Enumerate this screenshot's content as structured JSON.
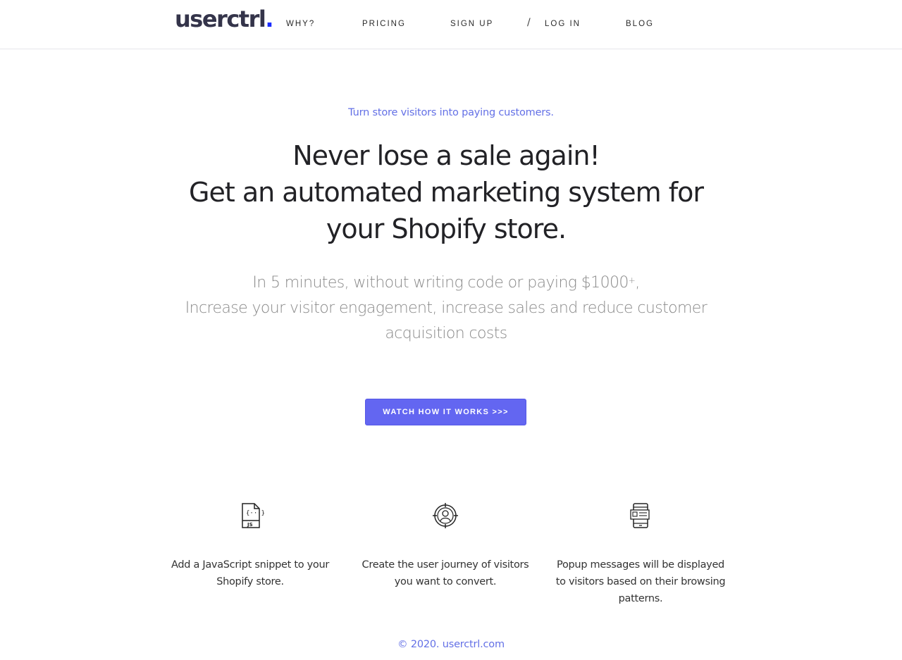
{
  "header": {
    "logo_text": "userctrl",
    "logo_dot": ".",
    "nav": {
      "why": "WHY?",
      "pricing": "PRICING",
      "signup": "SIGN UP",
      "separator": "/",
      "login": "LOG IN",
      "blog": "BLOG"
    }
  },
  "hero": {
    "tagline": "Turn store visitors into paying customers.",
    "headline_line1": "Never lose a sale again!",
    "headline_line2": "Get an automated marketing system for",
    "headline_line3": "your Shopify store.",
    "sub_line1_a": "In 5 minutes, without writing code or paying $1000",
    "sub_line1_sup": "+",
    "sub_line1_b": ",",
    "sub_line2": "Increase your visitor engagement, increase sales and reduce customer",
    "sub_line3": "acquisition costs",
    "cta_label": "WATCH HOW IT WORKS >>>"
  },
  "features": [
    {
      "icon": "javascript-file-icon",
      "icon_label": "JS",
      "text": "Add a JavaScript snippet to your Shopify store."
    },
    {
      "icon": "target-user-icon",
      "text": "Create the user journey of visitors you want to convert."
    },
    {
      "icon": "mobile-popup-icon",
      "text": "Popup messages will be displayed to visitors based on their browsing patterns."
    }
  ],
  "footer": {
    "copyright": "© 2020. userctrl.com"
  },
  "colors": {
    "accent": "#6366f1",
    "link": "#6370e6",
    "logo_dot": "#1a2cff",
    "logo": "#34344a"
  }
}
